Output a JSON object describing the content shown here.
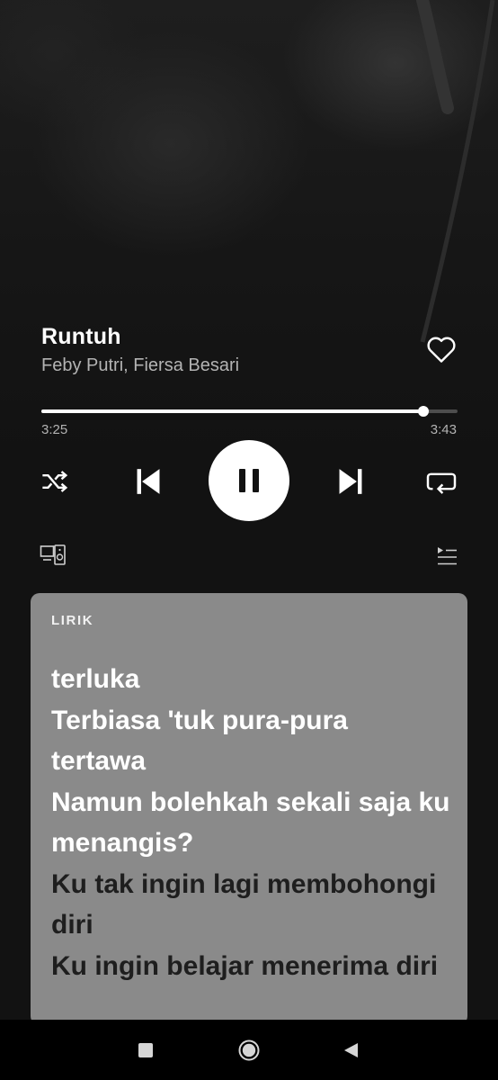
{
  "track": {
    "title": "Runtuh",
    "artist": "Feby Putri, Fiersa Besari",
    "liked": false
  },
  "playback": {
    "elapsed": "3:25",
    "duration": "3:43",
    "progress_fraction": 0.919,
    "state": "playing"
  },
  "controls": {
    "shuffle_icon": "shuffle-icon",
    "previous_icon": "skip-previous-icon",
    "pause_icon": "pause-icon",
    "next_icon": "skip-next-icon",
    "repeat_icon": "repeat-icon",
    "devices_icon": "connect-devices-icon",
    "queue_icon": "queue-icon"
  },
  "lyrics": {
    "label": "LIRIK",
    "lines": [
      {
        "text": "terluka",
        "state": "active"
      },
      {
        "text": "Terbiasa 'tuk pura-pura",
        "state": "active"
      },
      {
        "text": "tertawa",
        "state": "active"
      },
      {
        "text": "Namun bolehkah sekali saja ku",
        "state": "active"
      },
      {
        "text": "menangis?",
        "state": "active"
      },
      {
        "text": "Ku tak ingin lagi membohongi",
        "state": "upcoming"
      },
      {
        "text": "diri",
        "state": "upcoming"
      },
      {
        "text": "Ku ingin belajar menerima diri",
        "state": "upcoming"
      }
    ]
  },
  "colors": {
    "background": "#121212",
    "lyrics_card": "#8a8a8a",
    "lyric_active": "#ffffff",
    "lyric_upcoming": "#1e1e1e",
    "secondary_text": "#b3b3b3"
  },
  "system_nav": {
    "recents_icon": "square-recents-icon",
    "home_icon": "circle-home-icon",
    "back_icon": "triangle-back-icon"
  }
}
